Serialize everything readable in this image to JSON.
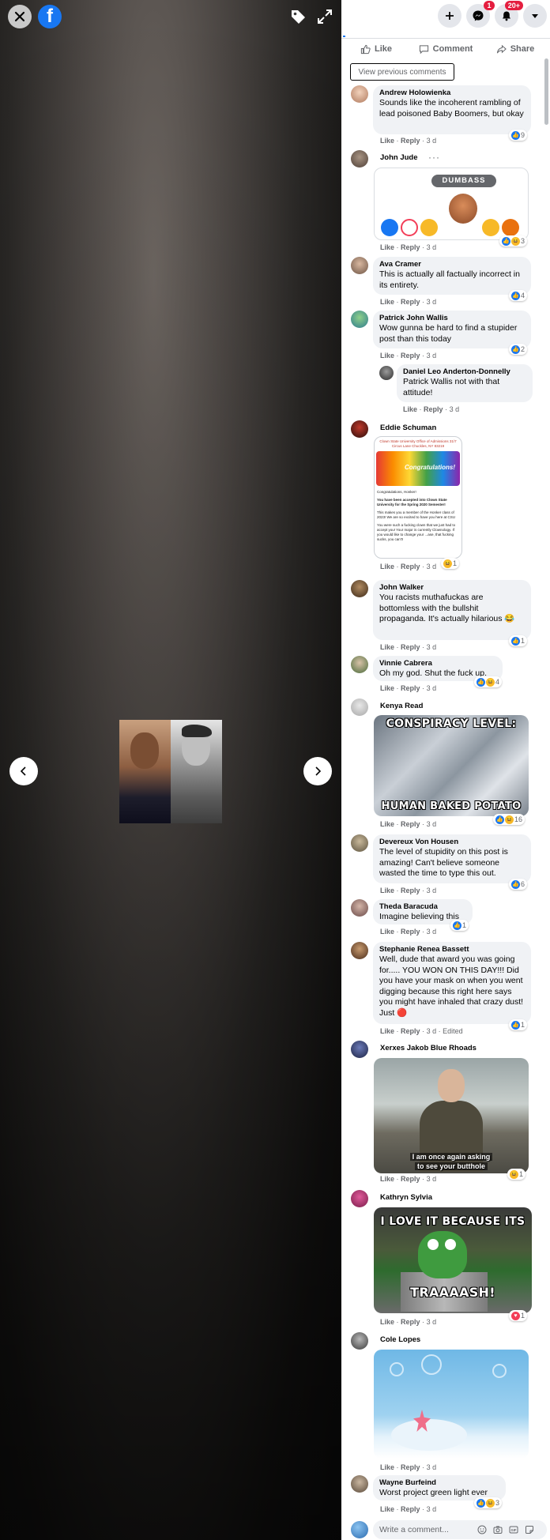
{
  "viewer": {
    "logo_letter": "f",
    "prev_label": "‹",
    "next_label": "›"
  },
  "topbar": {
    "messenger_badge": "1",
    "notifications_badge": "20+"
  },
  "actions": {
    "like": "Like",
    "comment": "Comment",
    "share": "Share"
  },
  "view_previous": "View previous comments",
  "meta_labels": {
    "like": "Like",
    "reply": "Reply",
    "sep": "·"
  },
  "comments": [
    {
      "author": "Andrew Holowienka",
      "text": "Sounds like the incoherent rambling of lead poisoned Baby Boomers, but okay",
      "time": "3 d",
      "reactions": "9"
    },
    {
      "author": "John Jude",
      "time": "3 d",
      "reactions": "3",
      "sticker_label": "DUMBASS",
      "dots": "···"
    },
    {
      "author": "Ava Cramer",
      "text": "This is actually all factually incorrect in its entirety.",
      "time": "3 d",
      "reactions": "4"
    },
    {
      "author": "Patrick John Wallis",
      "text": "Wow gunna be hard to find a stupider post than this today",
      "time": "3 d",
      "reactions": "2"
    },
    {
      "author": "Daniel Leo Anderton-Donnelly",
      "text": "Patrick Wallis not with that attitude!",
      "time": "3 d"
    },
    {
      "author": "Eddie Schuman",
      "time": "3 d",
      "reactions": "1",
      "letter": {
        "header": "Clown State University Office of Admissions 31/7 Circus Lane Chuckles, NY 83219",
        "banner": "Congratulations!",
        "greeting": "Congratulations, Honker!",
        "body1": "You have been accepted into Clown State University for the Spring 2020 Semester!",
        "body2": "This makes you a member of the Honker class of 2023! We are so excited to have you here at CSU",
        "body3": "You were such a fucking clown that we just had to accept you! Your major is currently Clownology. If you would like to change your ...ase, that fucking sucks, you can't!"
      }
    },
    {
      "author": "John Walker",
      "text": "You racists muthafuckas are bottomless with the bullshit propaganda. It's actually hilarious 😂",
      "time": "3 d",
      "reactions": "1"
    },
    {
      "author": "Vinnie Cabrera",
      "text": "Oh my god. Shut the fuck up.",
      "time": "3 d",
      "reactions": "4"
    },
    {
      "author": "Kenya Read",
      "time": "3 d",
      "reactions": "16",
      "meme_top": "CONSPIRACY LEVEL:",
      "meme_bottom": "HUMAN BAKED POTATO"
    },
    {
      "author": "Devereux Von Housen",
      "text": "The level of stupidity on this post is amazing! Can't believe someone wasted the time to type this out.",
      "time": "3 d",
      "reactions": "6"
    },
    {
      "author": "Theda Baracuda",
      "text": "Imagine believing this",
      "time": "3 d",
      "reactions": "1"
    },
    {
      "author": "Stephanie Renea Bassett",
      "text": "Well, dude that award you was going for..... YOU WON ON THIS DAY!!! Did you have your mask on when you went digging because this right here says you might have inhaled that crazy dust! Just 🔴",
      "time": "3 d",
      "edited": "Edited",
      "reactions": "1"
    },
    {
      "author": "Xerxes Jakob Blue Rhoads",
      "time": "3 d",
      "reactions": "1",
      "subtitle1": "I am once again asking",
      "subtitle2": "to see your butthole"
    },
    {
      "author": "Kathryn Sylvia",
      "time": "3 d",
      "reactions": "1",
      "meme_top": "I LOVE IT BECAUSE ITS",
      "meme_bottom": "TRAAAASH!"
    },
    {
      "author": "Cole Lopes",
      "time": "3 d"
    },
    {
      "author": "Wayne Burfeind",
      "text": "Worst project green light ever",
      "time": "3 d",
      "reactions": "3"
    }
  ],
  "composer": {
    "placeholder": "Write a comment..."
  },
  "colors": {
    "fb_blue": "#1877f2",
    "bubble": "#f0f2f5",
    "secondary_text": "#65676b",
    "badge_red": "#e41e3f"
  }
}
